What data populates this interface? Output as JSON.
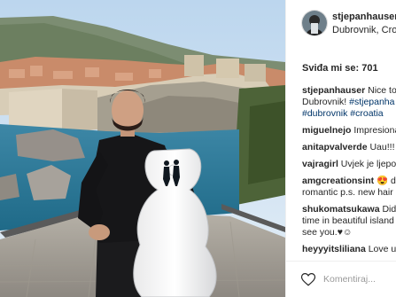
{
  "post": {
    "username": "stjepanhauser",
    "location": "Dubrovnik, Croa",
    "likes_text": "Sviđa mi se: 701"
  },
  "caption": {
    "username": "stjepanhauser",
    "line1": "Nice to",
    "line2_plain": "Dubrovnik! ",
    "line2_tag": "#stjepanha",
    "line3_tag1": "#dubrovnik",
    "line3_tag2": "#croatia"
  },
  "comments": [
    {
      "username": "miguelnejo",
      "text": "Impresiona"
    },
    {
      "username": "anitapvalverde",
      "text": "Uau!!!"
    },
    {
      "username": "vajragirl",
      "text": "Uvjek je ljepo"
    },
    {
      "username": "amgcreationsint",
      "text": "😍 dub",
      "line2": "romantic p.s. new hair"
    },
    {
      "username": "shukomatsukawa",
      "text": "Did",
      "line2": "time in beautiful island",
      "line3": "see you.♥☺"
    },
    {
      "username": "heyyyitsliliana",
      "text": "Love u"
    }
  ],
  "footer": {
    "comment_placeholder": "Komentiraj...",
    "like_icon": "heart-outline-icon"
  },
  "colors": {
    "link": "#003569",
    "text": "#262626",
    "border": "#efefef"
  }
}
